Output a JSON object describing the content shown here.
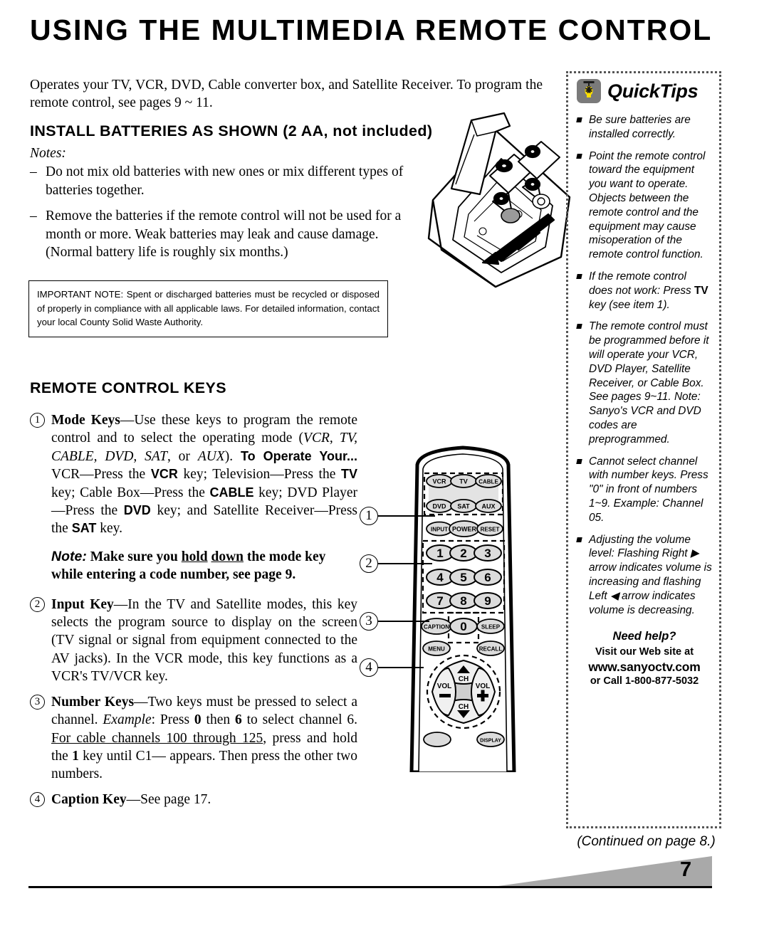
{
  "document": {
    "title": "USING THE MULTIMEDIA REMOTE CONTROL",
    "page_number": "7",
    "continued": "(Continued on page 8.)"
  },
  "intro": {
    "text": "Operates your TV, VCR, DVD, Cable converter box, and Satellite Receiver. To program the remote control, see pages 9 ~ 11."
  },
  "install_section": {
    "heading": "INSTALL BATTERIES AS SHOWN (2 AA, not included)",
    "notes_label": "Notes:",
    "notes": [
      "Do not mix old batteries with new ones or mix different types of batteries together.",
      "Remove the batteries if the remote control will not be used for a month or more. Weak batteries may leak and cause damage. (Normal battery life is roughly six months.)"
    ]
  },
  "important_note": {
    "text": "IMPORTANT NOTE: Spent or discharged batteries must be recycled or disposed of properly in compliance with all applicable laws. For detailed information, contact your local County Solid Waste Authority."
  },
  "keys_section": {
    "heading": "REMOTE CONTROL KEYS",
    "items": [
      {
        "number": "1",
        "title": "Mode Keys",
        "body": "Use these keys to program the remote control and to select the operating mode (VCR, TV, CABLE, DVD, SAT, or AUX). To Operate Your... VCR—Press the VCR key; Television—Press the TV key; Cable Box—Press the CABLE key; DVD Player—Press the DVD key; and Satellite Receiver—Press the SAT key."
      },
      {
        "number": "2",
        "title": "Input Key",
        "body": "In the TV and Satellite modes, this key selects the program source to display on the screen (TV signal or signal from equipment connected to the AV jacks). In the VCR mode, this key functions as a VCR's TV/VCR key."
      },
      {
        "number": "3",
        "title": "Number Keys",
        "body": "Two keys must be pressed to select a channel. Example: Press 0 then 6 to select channel 6. For cable channels 100 through 125, press and hold the 1 key until C1-- appears. Then press the other two numbers."
      },
      {
        "number": "4",
        "title": "Caption Key",
        "body": "See page 17."
      }
    ],
    "mode_note": "Note: Make sure you hold down the mode key while entering a code number, see page 9."
  },
  "quicktips": {
    "title": "QuickTips",
    "icon": "lightbulb-icon",
    "tips": [
      "Be sure batteries are installed correctly.",
      "Point the remote control toward the equipment you want to operate. Objects between the remote control and the equipment may cause misoperation of the remote control function.",
      "If the remote control does not work: Press TV key (see item 1).",
      "The remote control must be programmed before it will operate your VCR, DVD Player, Satellite Receiver, or Cable Box. See pages 9~11. Note: Sanyo's VCR and DVD codes are preprogrammed.",
      "Cannot select channel with number keys. Press \"0\" in front of numbers 1~9. Example: Channel 05.",
      "Adjusting the volume level: Flashing Right ▶ arrow indicates volume is increasing and flashing Left ◀ arrow indicates volume is decreasing."
    ],
    "need_help": {
      "title": "Need help?",
      "line1": "Visit our Web site at",
      "website": "www.sanyoctv.com",
      "line2": "or Call 1-800-877-5032"
    }
  },
  "remote_diagram": {
    "mode_keys": [
      "VCR",
      "TV",
      "CABLE",
      "DVD",
      "SAT",
      "AUX"
    ],
    "control_keys": [
      "INPUT",
      "POWER",
      "RESET"
    ],
    "number_keys": [
      "1",
      "2",
      "3",
      "4",
      "5",
      "6",
      "7",
      "8",
      "9",
      "0"
    ],
    "function_keys": [
      "CAPTION",
      "SLEEP",
      "MENU",
      "RECALL"
    ],
    "nav_keys": [
      "CH",
      "VOL",
      "VOL",
      "CH"
    ],
    "callouts": [
      "1",
      "2",
      "3",
      "4"
    ]
  },
  "colors": {
    "wedge_gray": "#a9a9a9",
    "bulb_yellow": "#ffe000",
    "bulb_box_gray": "#7a7a7a",
    "key_gray": "#d8d8d8"
  }
}
